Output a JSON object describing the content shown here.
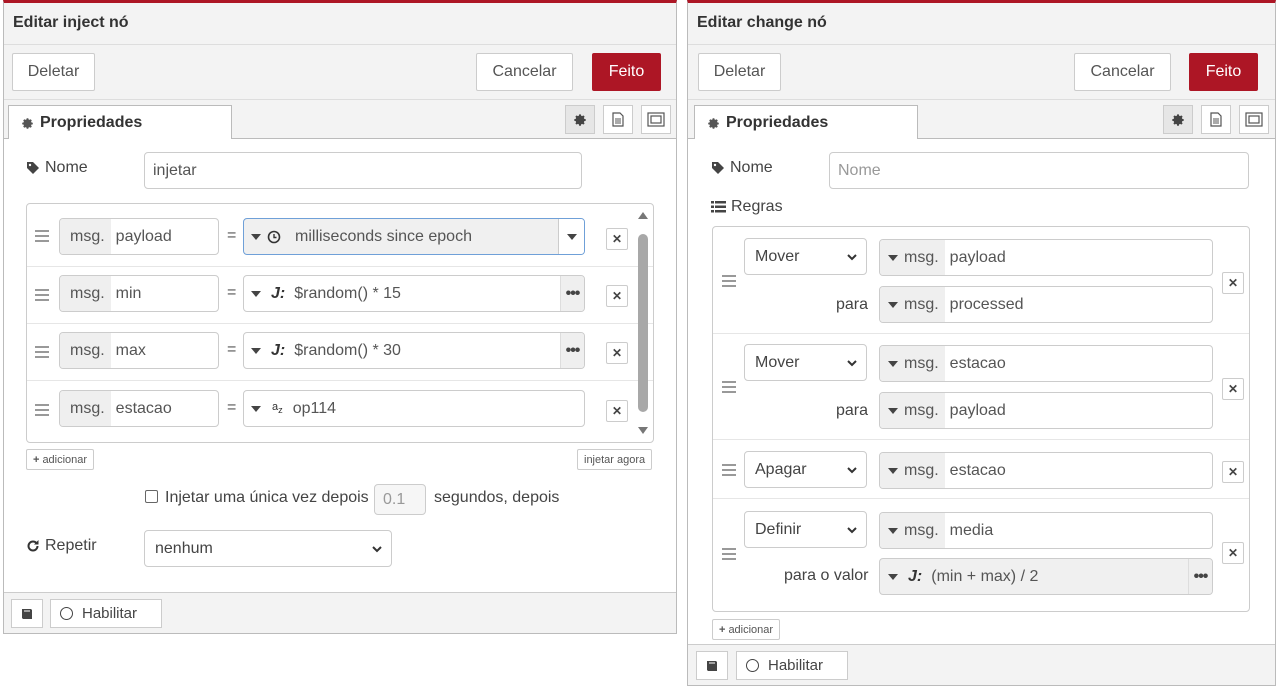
{
  "colors": {
    "accent": "#ad1625",
    "tray_bg": "#f3f3f3",
    "border": "#cccccc"
  },
  "inject": {
    "title": "Editar inject nó",
    "delete_label": "Deletar",
    "cancel_label": "Cancelar",
    "done_label": "Feito",
    "tab_label": "Propriedades",
    "name_label": "Nome",
    "name_value": "injetar",
    "props": [
      {
        "prefix": "msg.",
        "key": "payload",
        "type_icon": "clock-icon",
        "value": "milliseconds since epoch"
      },
      {
        "prefix": "msg.",
        "key": "min",
        "type_icon": "jsonata-icon",
        "value": "$random() * 15"
      },
      {
        "prefix": "msg.",
        "key": "max",
        "type_icon": "jsonata-icon",
        "value": "$random() * 30"
      },
      {
        "prefix": "msg.",
        "key": "estacao",
        "type_icon": "string-icon",
        "value": "op114"
      }
    ],
    "equals": "=",
    "add_label": "adicionar",
    "inject_now_label": "injetar agora",
    "once_label": "Injetar uma única vez depois",
    "once_delay_placeholder": "0.1",
    "once_suffix": "segundos, depois",
    "repeat_label": "Repetir",
    "repeat_value": "nenhum",
    "enable_label": "Habilitar"
  },
  "change": {
    "title": "Editar change nó",
    "delete_label": "Deletar",
    "cancel_label": "Cancelar",
    "done_label": "Feito",
    "tab_label": "Propriedades",
    "name_label": "Nome",
    "name_placeholder": "Nome",
    "rules_label": "Regras",
    "rules": [
      {
        "action": "Mover",
        "prefix": "msg.",
        "target": "payload",
        "to_label": "para",
        "to_prefix": "msg.",
        "to_value": "processed"
      },
      {
        "action": "Mover",
        "prefix": "msg.",
        "target": "estacao",
        "to_label": "para",
        "to_prefix": "msg.",
        "to_value": "payload"
      },
      {
        "action": "Apagar",
        "prefix": "msg.",
        "target": "estacao"
      },
      {
        "action": "Definir",
        "prefix": "msg.",
        "target": "media",
        "to_label": "para o valor",
        "to_value": "(min + max) / 2"
      }
    ],
    "add_label": "adicionar",
    "enable_label": "Habilitar"
  }
}
